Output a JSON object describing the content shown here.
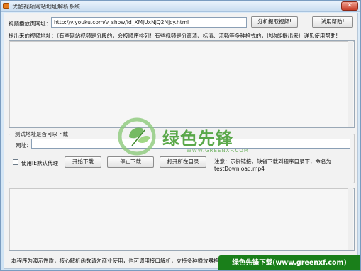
{
  "window": {
    "title": "优酷视频网站地址解析系统",
    "close_glyph": "✕"
  },
  "url_section": {
    "label": "视频播放页网址：",
    "input_value": "http://v.youku.com/v_show/id_XMjUxNjQ2Njcy.html",
    "parse_button": "分析提取视频!",
    "help_button": "试用帮助!"
  },
  "result": {
    "label": "提出来的视频地址：（有些网站视频是分段的，会按顺序排列！有些视频是分高清、标清、流畅等多种格式的，也均能提出来）详见使用帮助!"
  },
  "test_group": {
    "title": "测试地址是否可以下载",
    "url_label": "网址：",
    "url_value": "",
    "proxy_checkbox_label": "使用IE默认代理",
    "start_download": "开始下载",
    "stop_download": "停止下载",
    "open_dir": "打开所在目录",
    "note": "注意：示例链接，缺省下载到程序目录下，命名为 testDownload.mp4"
  },
  "footer": {
    "text": "本程序为演示性质，核心解析函数请勿商业使用，也可调用接口解析，支持多种播放器格式..."
  },
  "watermark": {
    "name": "绿色先锋",
    "url": "WWW.GREENXF.COM",
    "banner": "绿色先锋下载(www.greenxf.com)",
    "color": "#3f9b2c"
  }
}
